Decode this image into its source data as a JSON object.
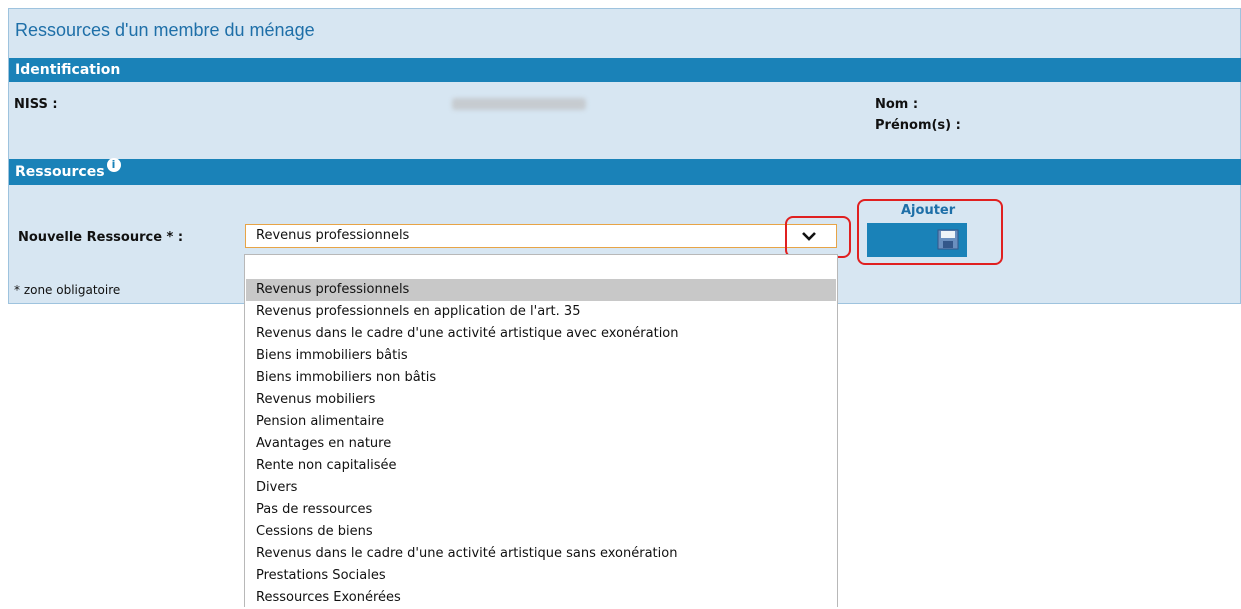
{
  "page_title": "Ressources d'un membre du ménage",
  "identification": {
    "title": "Identification",
    "niss_label": "NISS :",
    "nom_label": "Nom :",
    "prenom_label": "Prénom(s) :"
  },
  "ressources": {
    "title": "Ressources",
    "info_icon": "i",
    "nouvelle_label": "Nouvelle Ressource * :",
    "selected_value": "Revenus professionnels",
    "add_label": "Ajouter",
    "required_note": "* zone obligatoire"
  },
  "dropdown_options": [
    "Revenus professionnels",
    "Revenus professionnels en application de l'art. 35",
    "Revenus dans le cadre d'une activité artistique avec exonération",
    "Biens immobiliers bâtis",
    "Biens immobiliers non bâtis",
    "Revenus mobiliers",
    "Pension alimentaire",
    "Avantages en nature",
    "Rente non capitalisée",
    "Divers",
    "Pas de ressources",
    "Cessions de biens",
    "Revenus dans le cadre d'une activité artistique sans exonération",
    "Prestations Sociales",
    "Ressources Exonérées"
  ],
  "colors": {
    "header_bar": "#1a82b8",
    "panel_bg": "#d7e6f2",
    "title_text": "#1e6fa8",
    "highlight": "#e02020",
    "select_border": "#e7a447"
  }
}
